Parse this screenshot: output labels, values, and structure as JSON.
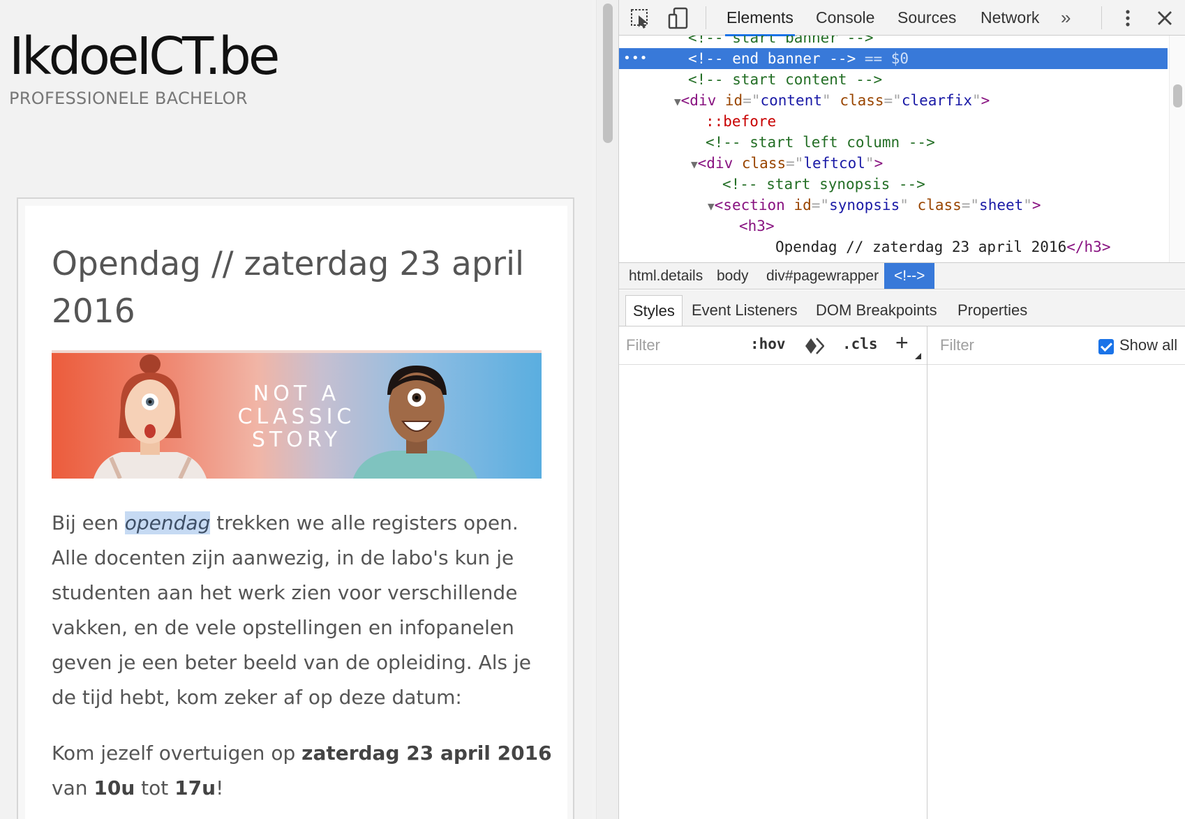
{
  "site": {
    "title": "IkdoeICT.be",
    "subtitle": "PROFESSIONELE BACHELOR"
  },
  "article": {
    "title": "Opendag // zaterdag 23 april 2016",
    "banner_lines": [
      "NOT A",
      "CLASSIC",
      "STORY"
    ],
    "para1": {
      "before": "Bij een ",
      "highlight": "opendag",
      "after": " trekken we alle registers open. Alle docenten zijn aanwezig, in de labo's kun je studenten aan het werk zien voor verschillende vakken, en de vele opstellingen en infopanelen geven je een beter beeld van de opleiding. Als je de tijd hebt, kom zeker af op deze datum:"
    },
    "para2": {
      "t1": "Kom jezelf overtuigen op ",
      "b1": "zaterdag 23 april 2016",
      "t2": " van ",
      "b2": "10u",
      "t3": " tot ",
      "b3": "17u",
      "t4": "!"
    }
  },
  "devtools": {
    "tabs": [
      "Elements",
      "Console",
      "Sources",
      "Network"
    ],
    "active_tab": "Elements",
    "more_tabs": "»",
    "dom": {
      "l0": "<!-- start banner -->",
      "l1": "<!-- end banner -->",
      "l1_ref": " == $0",
      "l2": "<!-- start content -->",
      "l3_tag": "div",
      "l3_attr1": "id",
      "l3_val1": "content",
      "l3_attr2": "class",
      "l3_val2": "clearfix",
      "l4": "::before",
      "l5": "<!-- start left column -->",
      "l6_tag": "div",
      "l6_attr1": "class",
      "l6_val1": "leftcol",
      "l7": "<!-- start synopsis -->",
      "l8_tag": "section",
      "l8_attr1": "id",
      "l8_val1": "synopsis",
      "l8_attr2": "class",
      "l8_val2": "sheet",
      "l9_tag": "h3",
      "l10_text": "Opendag // zaterdag 23 april 2016",
      "l10_close": "h3"
    },
    "breadcrumb": [
      "html.details",
      "body",
      "div#pagewrapper",
      "<!-->"
    ],
    "sub_tabs": [
      "Styles",
      "Event Listeners",
      "DOM Breakpoints",
      "Properties"
    ],
    "active_sub_tab": "Styles",
    "filter_placeholder": "Filter",
    "hov": ":hov",
    "cls": ".cls",
    "plus": "+",
    "computed_filter_placeholder": "Filter",
    "show_all_label": "Show all",
    "show_all_checked": true
  },
  "colors": {
    "selection": "#3879d9",
    "accent": "#1a73e8",
    "highlight": "#c6daf3"
  }
}
